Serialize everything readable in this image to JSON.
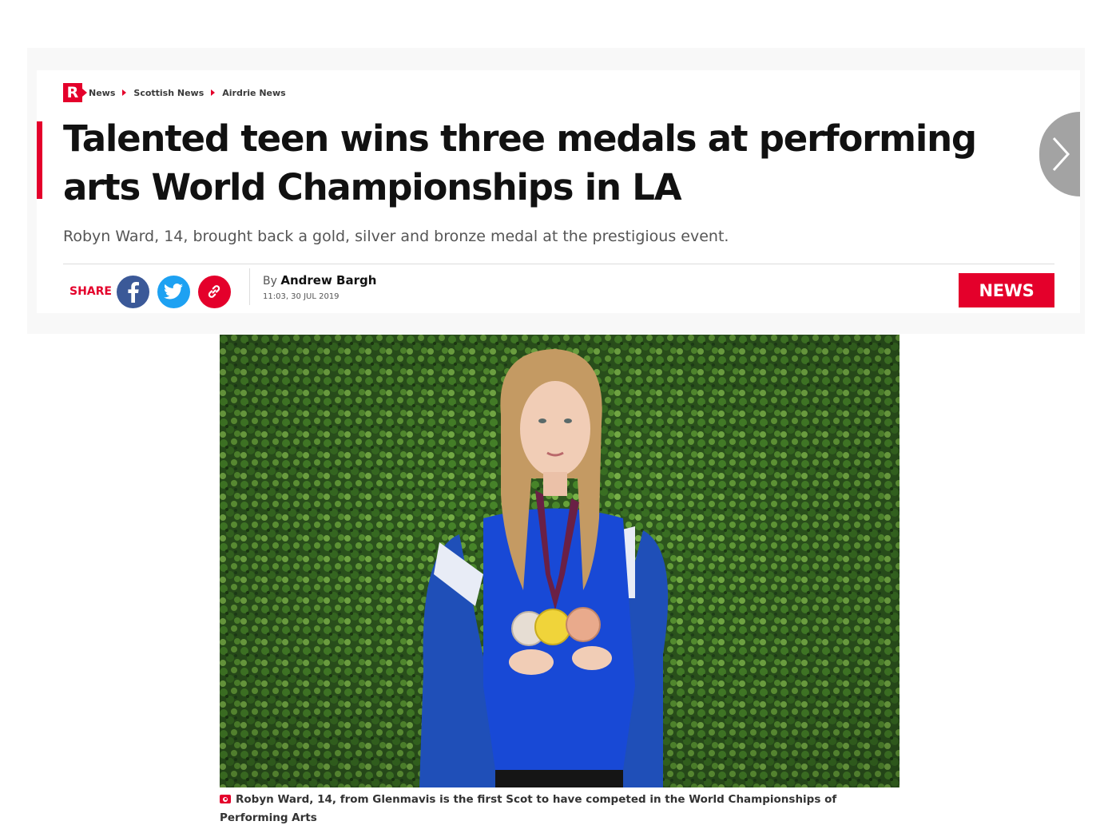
{
  "breadcrumb": {
    "logo_text": "R",
    "items": [
      "News",
      "Scottish News",
      "Airdrie News"
    ]
  },
  "article": {
    "headline": "Talented teen wins three medals at performing arts World Championships in LA",
    "standfirst": "Robyn Ward, 14, brought back a gold, silver and bronze medal at the prestigious event.",
    "byline_prefix": "By",
    "author": "Andrew Bargh",
    "timestamp": "11:03, 30 JUL 2019",
    "category": "NEWS"
  },
  "share": {
    "label": "SHARE",
    "buttons": [
      "facebook-icon",
      "twitter-icon",
      "link-icon"
    ]
  },
  "image": {
    "caption": "Robyn Ward, 14, from Glenmavis is the first Scot to have competed in the World Championships of Performing Arts"
  },
  "colors": {
    "brand_red": "#e4002b",
    "facebook_blue": "#3b5998",
    "twitter_blue": "#1da1f2",
    "arrow_grey": "#a3a3a3"
  }
}
